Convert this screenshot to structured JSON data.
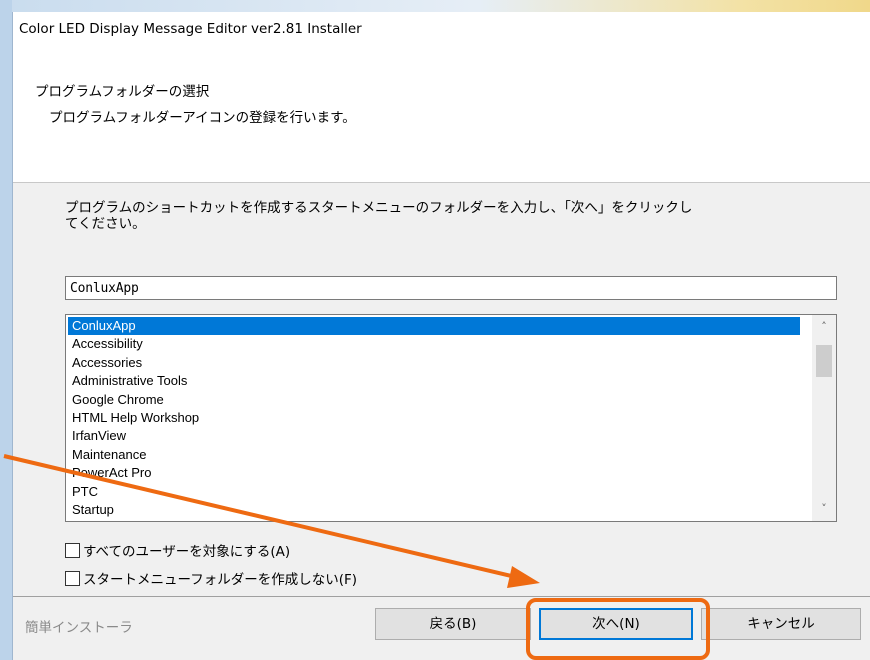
{
  "window": {
    "title": "Color LED Display Message Editor ver2.81 Installer"
  },
  "header": {
    "title": "プログラムフォルダーの選択",
    "subtitle": "プログラムフォルダーアイコンの登録を行います。"
  },
  "instructions": {
    "line1": "プログラムのショートカットを作成するスタートメニューのフォルダーを入力し、「次へ」をクリックし",
    "line2": "てください。"
  },
  "folder_input": {
    "value": "ConluxApp"
  },
  "folder_list": {
    "items": [
      "ConluxApp",
      "Accessibility",
      "Accessories",
      "Administrative Tools",
      "Google Chrome",
      "HTML Help Workshop",
      "IrfanView",
      "Maintenance",
      "PowerAct Pro",
      "PTC",
      "Startup"
    ],
    "selected": "ConluxApp"
  },
  "options": {
    "all_users": "すべてのユーザーを対象にする(A)",
    "no_start_menu_folder": "スタートメニューフォルダーを作成しない(F)"
  },
  "footer": {
    "label": "簡単インストーラ",
    "back": "戻る(B)",
    "next": "次へ(N)",
    "cancel": "キャンセル"
  },
  "annotation": {
    "color": "#ee6a12"
  },
  "colors": {
    "selection": "#0078d7",
    "dialog_bg": "#f0f0f0"
  },
  "icons": {
    "scroll_up": "chevron-up-icon",
    "scroll_down": "chevron-down-icon",
    "annotation_arrow": "arrow-icon"
  }
}
